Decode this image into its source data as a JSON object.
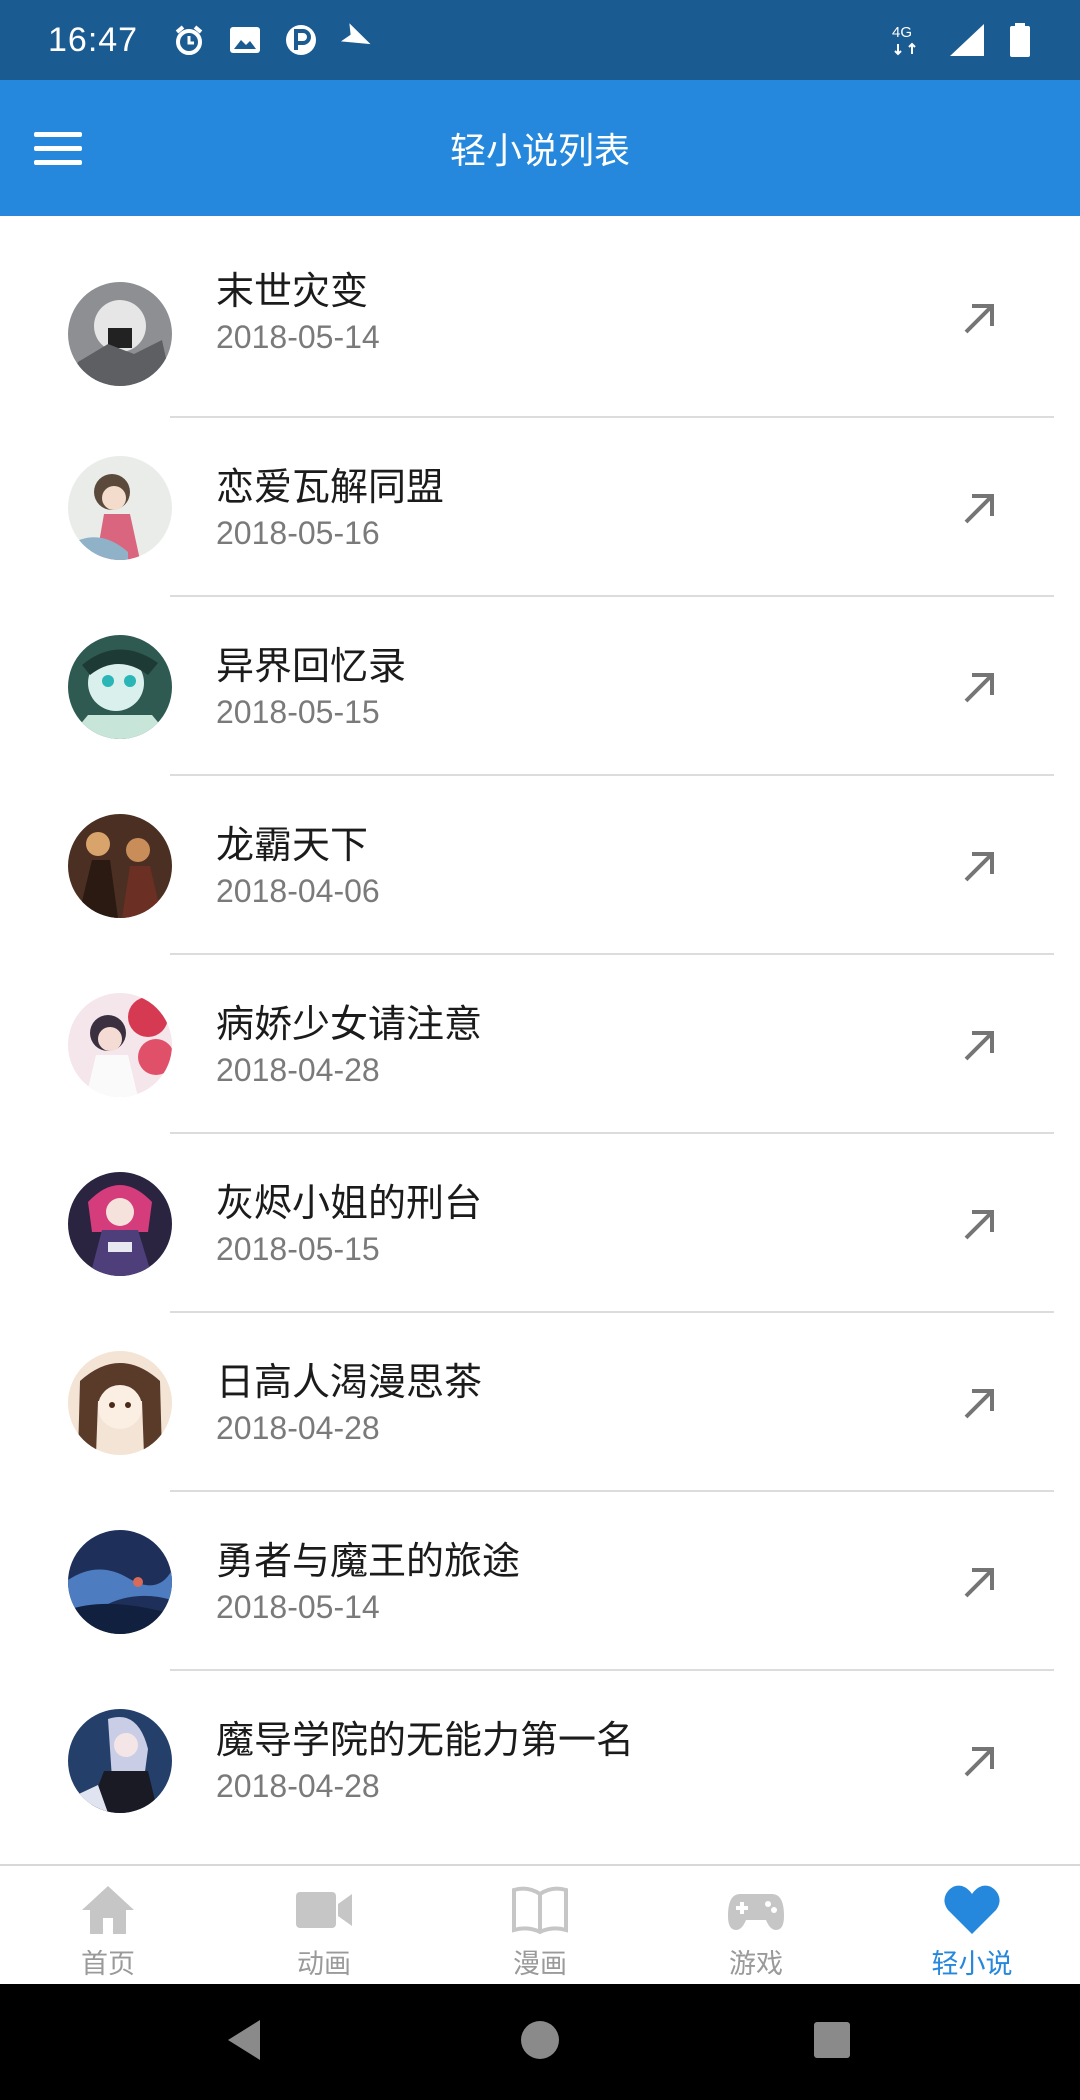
{
  "status_bar": {
    "time": "16:47",
    "network_label": "4G",
    "left_icons": [
      "alarm-icon",
      "image-icon",
      "parking-icon",
      "send-icon"
    ],
    "right_icons": [
      "network-4g-icon",
      "signal-icon",
      "battery-icon"
    ]
  },
  "app_bar": {
    "title": "轻小说列表",
    "menu_icon": "menu-icon"
  },
  "novels": [
    {
      "title": "末世灾变",
      "date": "2018-05-14"
    },
    {
      "title": "恋爱瓦解同盟",
      "date": "2018-05-16"
    },
    {
      "title": "异界回忆录",
      "date": "2018-05-15"
    },
    {
      "title": "龙霸天下",
      "date": "2018-04-06"
    },
    {
      "title": "病娇少女请注意",
      "date": "2018-04-28"
    },
    {
      "title": "灰烬小姐的刑台",
      "date": "2018-05-15"
    },
    {
      "title": "日高人渴漫思茶",
      "date": "2018-04-28"
    },
    {
      "title": "勇者与魔王的旅途",
      "date": "2018-05-14"
    },
    {
      "title": "魔导学院的无能力第一名",
      "date": "2018-04-28"
    }
  ],
  "bottom_nav": {
    "items": [
      {
        "label": "首页",
        "icon": "home-icon"
      },
      {
        "label": "动画",
        "icon": "video-camera-icon"
      },
      {
        "label": "漫画",
        "icon": "book-icon"
      },
      {
        "label": "游戏",
        "icon": "gamepad-icon"
      },
      {
        "label": "轻小说",
        "icon": "heart-icon",
        "active": true
      }
    ]
  },
  "colors": {
    "status_bar": "#1a5b91",
    "app_bar": "#2588dc",
    "active_tab": "#2588dc",
    "inactive_tab": "#c6c6c6"
  }
}
